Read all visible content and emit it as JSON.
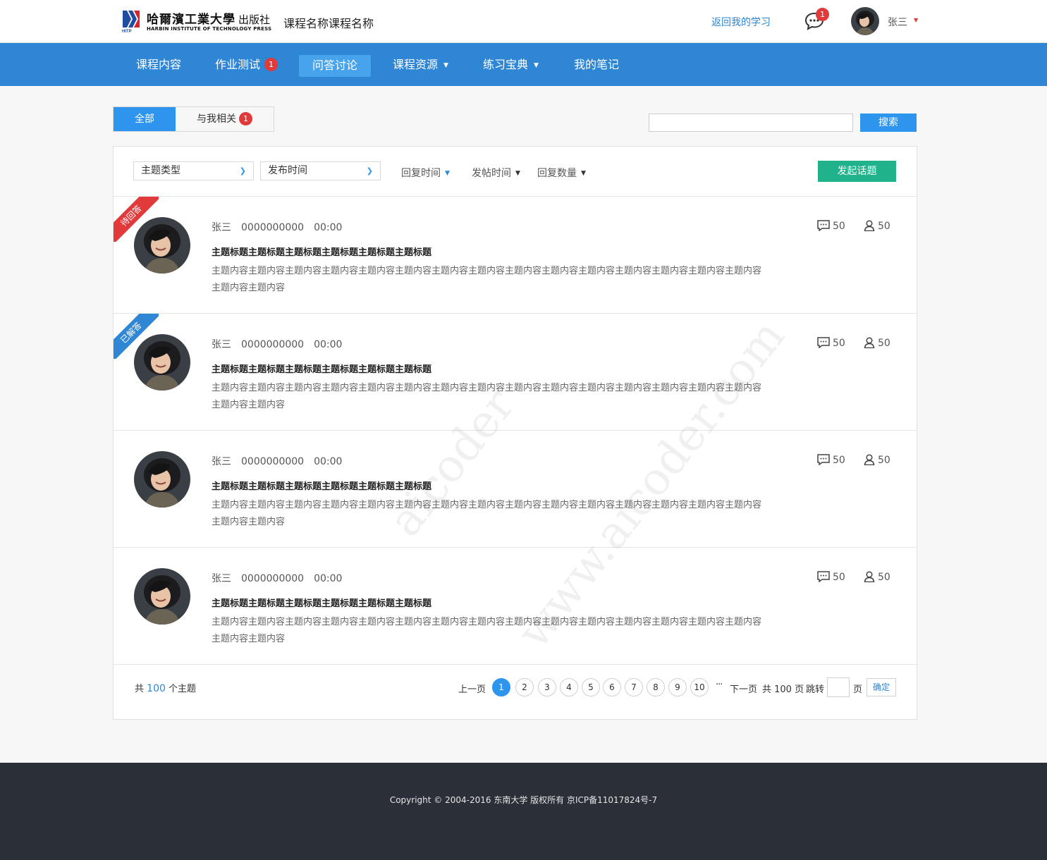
{
  "header": {
    "logo_cn": "哈爾濱工業大學",
    "logo_pub": "出版社",
    "logo_en": "HARBIN INSTITUTE OF TECHNOLOGY PRESS",
    "course_title": "课程名称课程名称",
    "back_link": "返回我的学习",
    "message_count": "1",
    "user_name": "张三",
    "caret": "▼"
  },
  "nav": {
    "items": [
      {
        "label": "课程内容"
      },
      {
        "label": "作业测试",
        "badge": "1"
      },
      {
        "label": "问答讨论"
      },
      {
        "label": "课程资源",
        "caret": "▼"
      },
      {
        "label": "练习宝典",
        "caret": "▼"
      },
      {
        "label": "我的笔记"
      }
    ],
    "active_index": 2
  },
  "filter_tabs": {
    "all": "全部",
    "mine": "与我相关",
    "mine_badge": "1"
  },
  "search": {
    "button": "搜索",
    "value": ""
  },
  "toolbar": {
    "topic_type": "主题类型",
    "publish_time": "发布时间",
    "sort_reply_time": "回复时间",
    "sort_post_time": "发帖时间",
    "sort_reply_count": "回复数量",
    "new_topic": "发起话题"
  },
  "topics": [
    {
      "ribbon": "待回答",
      "ribbon_color": "#e2393a",
      "author": "张三",
      "id": "0000000000",
      "time": "00:00",
      "title": "主题标题主题标题主题标题主题标题主题标题主题标题",
      "body": "主题内容主题内容主题内容主题内容主题内容主题内容主题内容主题内容主题内容主题内容主题内容主题内容主题内容主题内容主题内容主题内容主题内容",
      "replies": "50",
      "users": "50"
    },
    {
      "ribbon": "已解答",
      "ribbon_color": "#2e86d4",
      "author": "张三",
      "id": "0000000000",
      "time": "00:00",
      "title": "主题标题主题标题主题标题主题标题主题标题主题标题",
      "body": "主题内容主题内容主题内容主题内容主题内容主题内容主题内容主题内容主题内容主题内容主题内容主题内容主题内容主题内容主题内容主题内容主题内容",
      "replies": "50",
      "users": "50"
    },
    {
      "ribbon": "",
      "author": "张三",
      "id": "0000000000",
      "time": "00:00",
      "title": "主题标题主题标题主题标题主题标题主题标题主题标题",
      "body": "主题内容主题内容主题内容主题内容主题内容主题内容主题内容主题内容主题内容主题内容主题内容主题内容主题内容主题内容主题内容主题内容主题内容",
      "replies": "50",
      "users": "50"
    },
    {
      "ribbon": "",
      "author": "张三",
      "id": "0000000000",
      "time": "00:00",
      "title": "主题标题主题标题主题标题主题标题主题标题主题标题",
      "body": "主题内容主题内容主题内容主题内容主题内容主题内容主题内容主题内容主题内容主题内容主题内容主题内容主题内容主题内容主题内容主题内容主题内容",
      "replies": "50",
      "users": "50"
    }
  ],
  "pagination": {
    "total_prefix": "共",
    "total_count": "100",
    "total_suffix": "个主题",
    "prev": "上一页",
    "pages": [
      "1",
      "2",
      "3",
      "4",
      "5",
      "6",
      "7",
      "8",
      "9",
      "10"
    ],
    "current_page": "1",
    "ellipsis": "···",
    "next": "下一页",
    "page_total": "共 100 页",
    "jump_label": "跳转",
    "page_unit": "页",
    "confirm": "确定"
  },
  "footer": {
    "copyright": "Copyright © 2004-2016 东南大学 版权所有     京ICP备11017824号-7"
  },
  "watermark": {
    "line1": "aicoder",
    "line2": "www.aicoder.com"
  },
  "colors": {
    "primary": "#2e86d4",
    "accent": "#2e95ee",
    "badge_red": "#e2393a",
    "green": "#20b38b",
    "footer_bg": "#2b2f38"
  }
}
